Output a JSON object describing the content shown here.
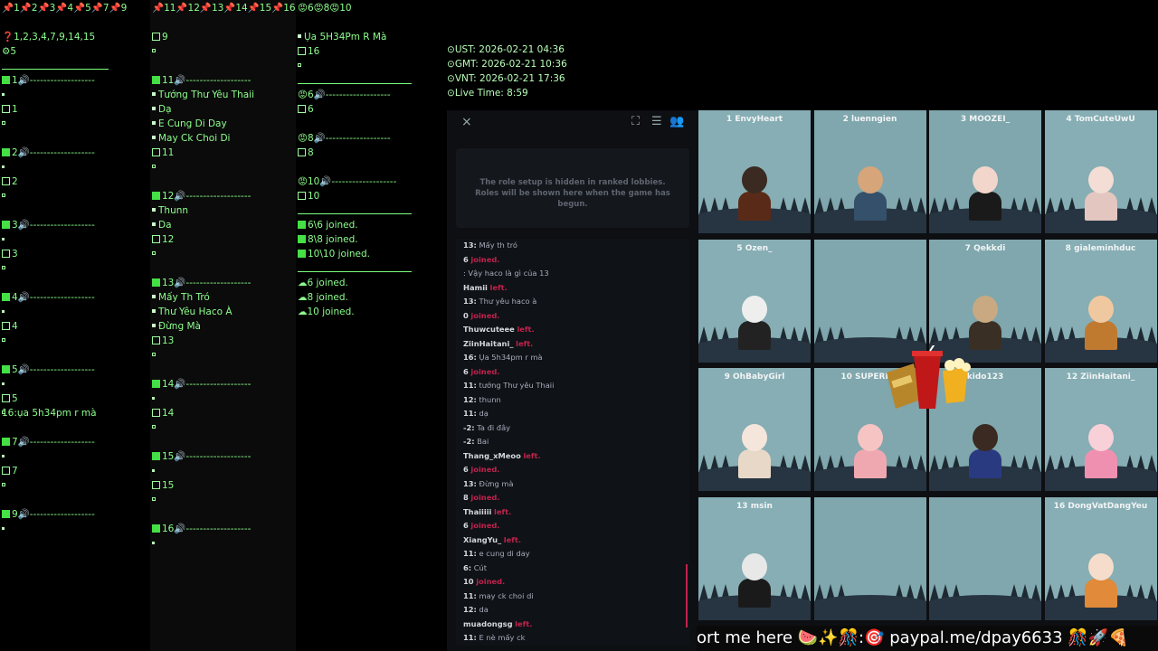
{
  "overlay": {
    "col1_header": "📌1📌2📌3📌4📌5📌7📌9",
    "col2_header": "📌11📌12📌13📌14📌15📌16",
    "col3_header": "😡6😡8😡10",
    "col1_info1": "❓1,2,3,4,7,9,14,15",
    "col1_info2": "⚙5",
    "col1_slots": [
      {
        "num": "1",
        "label": "1🔊-------------------",
        "check": "1"
      },
      {
        "num": "2",
        "label": "2🔊-------------------",
        "check": "2"
      },
      {
        "num": "3",
        "label": "3🔊-------------------",
        "check": "3"
      },
      {
        "num": "4",
        "label": "4🔊-------------------",
        "check": "4"
      },
      {
        "num": "5",
        "label": "5🔊-------------------",
        "check": "5",
        "note": "16:ụa 5h34pm r mà"
      },
      {
        "num": "7",
        "label": "7🔊-------------------",
        "check": "7"
      },
      {
        "num": "9",
        "label": "9🔊-------------------"
      }
    ],
    "col2_first": "9",
    "col2_blocks": [
      {
        "label": "11🔊-------------------",
        "lines": [
          "Tướng Thư Yêu Thaii",
          "Dạ",
          "E Cung Di Day",
          "May Ck Choi Di"
        ],
        "check": "11"
      },
      {
        "label": "12🔊-------------------",
        "lines": [
          "Thunn",
          "Da"
        ],
        "check": "12"
      },
      {
        "label": "13🔊-------------------",
        "lines": [
          "Mấy Th Tró",
          "Thư Yêu Haco À",
          "Đừng Mà"
        ],
        "check": "13"
      },
      {
        "label": "14🔊-------------------",
        "lines": [],
        "check": "14"
      },
      {
        "label": "15🔊-------------------",
        "lines": [],
        "check": "15"
      },
      {
        "label": "16🔊-------------------",
        "lines": []
      }
    ],
    "col3_top_line": "Ụa 5H34Pm R Mà",
    "col3_top_check": "16",
    "col3_blocks": [
      {
        "label": "😡6🔊-------------------",
        "check": "6"
      },
      {
        "label": "😡8🔊-------------------",
        "check": "8"
      },
      {
        "label": "😡10🔊-------------------",
        "check": "10"
      }
    ],
    "col3_joined": [
      "6\\6 joined.",
      "8\\8 joined.",
      "10\\10 joined."
    ],
    "col3_joined2": [
      "6 joined.",
      "8 joined.",
      "10 joined."
    ]
  },
  "times": {
    "ust": "UST: 2026-02-21 04:36",
    "gmt": "GMT: 2026-02-21 10:36",
    "vnt": "VNT: 2026-02-21 17:36",
    "live": "Live Time: 8:59"
  },
  "game": {
    "close_icon": "×",
    "role_notice": "The role setup is hidden in ranked lobbies. Roles will be shown here when the game has begun.",
    "chat": [
      {
        "name": "13:",
        "text": "Mấy th tró"
      },
      {
        "name": "6",
        "text": "joined.",
        "join": true
      },
      {
        "name": "",
        "text": ": Vậy haco là gì của 13"
      },
      {
        "name": "Hamii",
        "text": "left.",
        "join": true
      },
      {
        "name": "13:",
        "text": "Thư yêu haco à"
      },
      {
        "name": "0",
        "text": "joined.",
        "join": true
      },
      {
        "name": "Thuwcuteee",
        "text": "left.",
        "join": true
      },
      {
        "name": "ZiinHaitani_",
        "text": "left.",
        "join": true
      },
      {
        "name": "16:",
        "text": "Ụa 5h34pm r mà"
      },
      {
        "name": "6",
        "text": "joined.",
        "join": true
      },
      {
        "name": "11:",
        "text": "tướng Thư yêu Thaii"
      },
      {
        "name": "12:",
        "text": "thunn"
      },
      {
        "name": "11:",
        "text": "dạ"
      },
      {
        "name": "-2:",
        "text": "Ta đi đây"
      },
      {
        "name": "-2:",
        "text": "Bai"
      },
      {
        "name": "Thang_xMeoo",
        "text": "left.",
        "join": true
      },
      {
        "name": "6",
        "text": "joined.",
        "join": true
      },
      {
        "name": "13:",
        "text": "Đừng mà"
      },
      {
        "name": "8",
        "text": "joined.",
        "join": true
      },
      {
        "name": "Thaiiiii",
        "text": "left.",
        "join": true
      },
      {
        "name": "6",
        "text": "joined.",
        "join": true
      },
      {
        "name": "XiangYu_",
        "text": "left.",
        "join": true
      },
      {
        "name": "11:",
        "text": "e cung di day"
      },
      {
        "name": "6:",
        "text": "Cút"
      },
      {
        "name": "10",
        "text": "joined.",
        "join": true
      },
      {
        "name": "11:",
        "text": "may ck choi di"
      },
      {
        "name": "12:",
        "text": "da"
      },
      {
        "name": "muadongsg",
        "text": "left.",
        "join": true
      },
      {
        "name": "11:",
        "text": "E nè mấy ck"
      }
    ],
    "players": [
      {
        "label": "1 EnvyHeart",
        "skin": "#3a2a22",
        "shirt": "#5a2a18"
      },
      {
        "label": "2 luenngien",
        "skin": "#d6a57a",
        "shirt": "#34506a"
      },
      {
        "label": "3 MOOZEI_",
        "skin": "#f2d6cc",
        "shirt": "#1a1a1a"
      },
      {
        "label": "4 TomCuteUwU",
        "skin": "#f3ddd4",
        "shirt": "#e3c6c0"
      },
      {
        "label": "5 Ozen_",
        "skin": "#eeeeee",
        "shirt": "#222222"
      },
      {
        "label": "",
        "skin": "",
        "shirt": ""
      },
      {
        "label": "7 Qekkdi",
        "skin": "#c9a982",
        "shirt": "#3a2f24"
      },
      {
        "label": "8 gialeminhduc",
        "skin": "#f0c8a0",
        "shirt": "#c07a30"
      },
      {
        "label": "9 OhBabyGirl",
        "skin": "#f5e6dc",
        "shirt": "#e8d8c8"
      },
      {
        "label": "10 SUPERNO",
        "skin": "#f7c4c4",
        "shirt": "#f0a8b0"
      },
      {
        "label": "kido123",
        "skin": "#3a2a22",
        "shirt": "#2a3a80"
      },
      {
        "label": "12 ZiinHaitani_",
        "skin": "#f8d0d8",
        "shirt": "#f090b0"
      },
      {
        "label": "13 msin",
        "skin": "#e8e8e8",
        "shirt": "#1a1a1a"
      },
      {
        "label": "",
        "skin": "",
        "shirt": ""
      },
      {
        "label": "",
        "skin": "",
        "shirt": ""
      },
      {
        "label": "16 DongVatDangYeu",
        "skin": "#f5dccb",
        "shirt": "#e08a3a"
      }
    ]
  },
  "ticker": "ort me here 🍉✨🎊:🎯 paypal.me/dpay6633 🎊🚀🍕"
}
